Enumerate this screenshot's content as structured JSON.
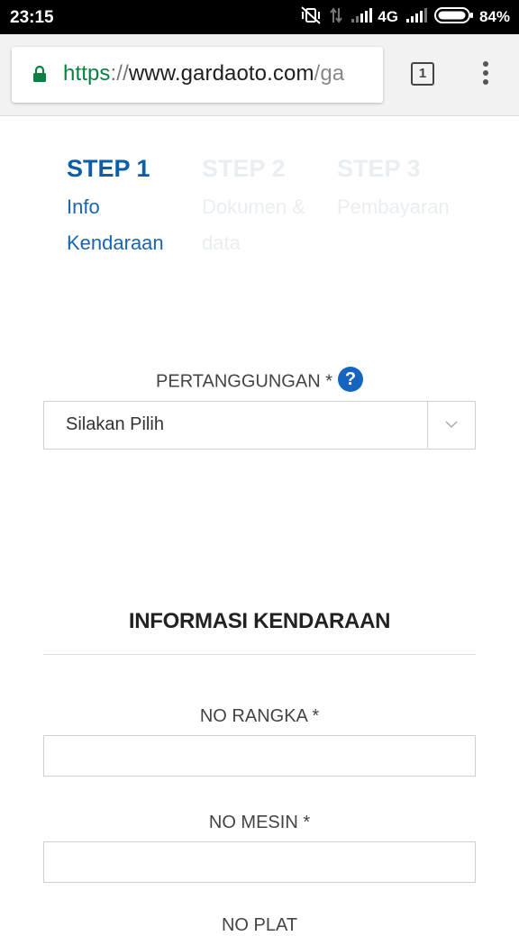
{
  "status_bar": {
    "time": "23:15",
    "network": "4G",
    "battery": "84%",
    "icons": [
      "vibrate-off-icon",
      "data-arrows-icon",
      "signal-icon",
      "signal-icon",
      "battery-icon"
    ]
  },
  "browser": {
    "url_scheme": "https",
    "url_separator": "://",
    "url_host": "www.gardaoto.com",
    "url_path": "/ga",
    "tab_count": "1",
    "accent": "#0b8043"
  },
  "steps": [
    {
      "title": "STEP 1",
      "line1": "Info",
      "line2": "Kendaraan",
      "state": "active"
    },
    {
      "title": "STEP 2",
      "line1": "Dokumen &",
      "line2": "data",
      "state": "inactive"
    },
    {
      "title": "STEP 3",
      "line1": "Pembayaran",
      "line2": "",
      "state": "inactive"
    }
  ],
  "form": {
    "coverage_label": "PERTANGGUNGAN *",
    "help_symbol": "?",
    "coverage_select_value": "Silakan Pilih",
    "section_title": "INFORMASI KENDARAAN",
    "chassis_label": "NO RANGKA *",
    "engine_label": "NO MESIN *",
    "plate_label": "NO PLAT"
  },
  "colors": {
    "step_active": "#0b5ea8",
    "help_icon": "#1565c0"
  }
}
